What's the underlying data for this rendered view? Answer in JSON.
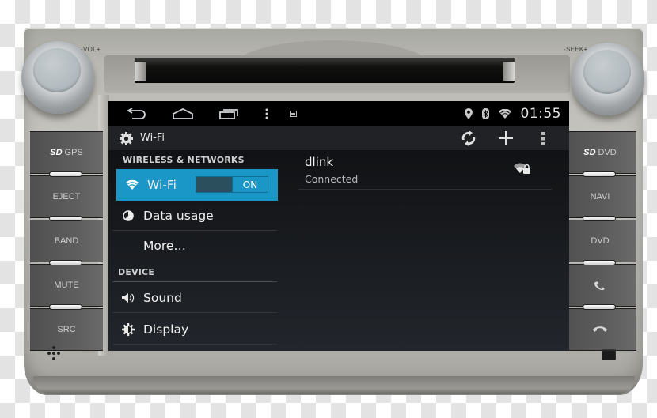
{
  "device": {
    "vol_label": "-VOL+",
    "seek_label": "-SEEK+",
    "left_buttons": [
      {
        "label": "GPS",
        "prefix": "SD"
      },
      {
        "label": "EJECT"
      },
      {
        "label": "BAND"
      },
      {
        "label": "MUTE"
      },
      {
        "label": "SRC"
      }
    ],
    "right_buttons": [
      {
        "label": "DVD",
        "prefix": "SD"
      },
      {
        "label": "NAVI"
      },
      {
        "label": "DVD"
      },
      {
        "label": "",
        "icon": "phone-answer-icon"
      },
      {
        "label": "",
        "icon": "phone-hangup-icon"
      }
    ]
  },
  "screen": {
    "system_bar": {
      "nav": [
        "back-icon",
        "home-icon",
        "recent-apps-icon",
        "menu-icon",
        "screenshot-icon"
      ],
      "status_icons": [
        "location-icon",
        "bluetooth-icon",
        "wifi-icon"
      ],
      "clock": "01:55"
    },
    "action_bar": {
      "title": "Wi-Fi",
      "icons": [
        "wps-icon",
        "add-network-icon",
        "overflow-menu-icon"
      ]
    },
    "settings": {
      "sections": [
        {
          "header": "WIRELESS & NETWORKS",
          "items": [
            {
              "label": "Wi-Fi",
              "icon": "wifi-icon",
              "active": true,
              "toggle": "ON"
            },
            {
              "label": "Data usage",
              "icon": "data-usage-icon"
            },
            {
              "label": "More…"
            }
          ]
        },
        {
          "header": "DEVICE",
          "items": [
            {
              "label": "Sound",
              "icon": "sound-icon"
            },
            {
              "label": "Display",
              "icon": "display-icon"
            }
          ]
        }
      ]
    },
    "networks": [
      {
        "name": "dlink",
        "status": "Connected",
        "icon": "wifi-locked-icon"
      }
    ],
    "colors": {
      "accent": "#1a97c7",
      "background": "#15171a"
    }
  }
}
